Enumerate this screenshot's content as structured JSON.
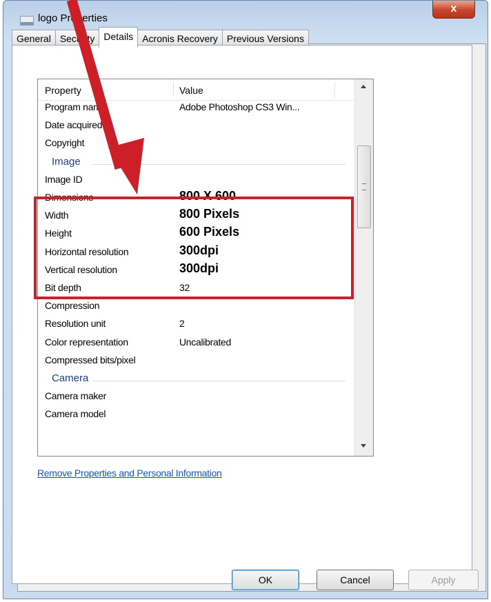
{
  "window": {
    "title": "logo Properties",
    "close_glyph": "x"
  },
  "tabs": [
    "General",
    "Security",
    "Details",
    "Acronis Recovery",
    "Previous Versions"
  ],
  "active_tab": "Details",
  "columns": {
    "property": "Property",
    "value": "Value"
  },
  "rows": [
    {
      "property": "Program name",
      "value": "Adobe Photoshop CS3 Win..."
    },
    {
      "property": "Date acquired",
      "value": ""
    },
    {
      "property": "Copyright",
      "value": ""
    },
    {
      "group": "Image"
    },
    {
      "property": "Image ID",
      "value": ""
    },
    {
      "property": "Dimensions",
      "value": "800 X 600"
    },
    {
      "property": "Width",
      "value": "800 Pixels"
    },
    {
      "property": "Height",
      "value": "600 Pixels"
    },
    {
      "property": "Horizontal resolution",
      "value": "300dpi"
    },
    {
      "property": "Vertical resolution",
      "value": "300dpi"
    },
    {
      "property": "Bit depth",
      "value": "32"
    },
    {
      "property": "Compression",
      "value": ""
    },
    {
      "property": "Resolution unit",
      "value": "2"
    },
    {
      "property": "Color representation",
      "value": "Uncalibrated"
    },
    {
      "property": "Compressed bits/pixel",
      "value": ""
    },
    {
      "group": "Camera"
    },
    {
      "property": "Camera maker",
      "value": ""
    },
    {
      "property": "Camera model",
      "value": ""
    }
  ],
  "remove_link": "Remove Properties and Personal Information",
  "buttons": {
    "ok": "OK",
    "cancel": "Cancel",
    "apply": "Apply"
  },
  "colors": {
    "highlight": "#c8202c",
    "arrow": "#cc1f28",
    "link": "#1a4fc0"
  }
}
